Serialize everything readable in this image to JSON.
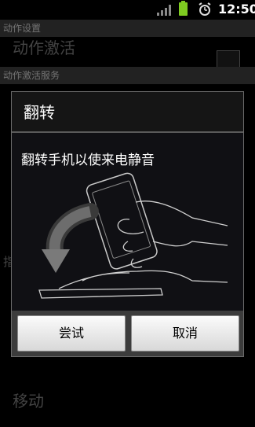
{
  "status_bar": {
    "time": "12:50"
  },
  "background": {
    "section_header_1": "动作设置",
    "item_partial": "动作激活",
    "section_header_2": "动作激活服务",
    "partial_left_char": "指",
    "item_move": "移动"
  },
  "dialog": {
    "title": "翻转",
    "message": "翻转手机以使来电静音",
    "try_button": "尝试",
    "cancel_button": "取消"
  },
  "icons": [
    "signal-icon",
    "battery-icon",
    "alarm-icon",
    "flip-gesture-illustration"
  ],
  "colors": {
    "battery": "#7ecb20",
    "dialog_bg": "#101014",
    "header_bg": "#3f3f3f"
  }
}
